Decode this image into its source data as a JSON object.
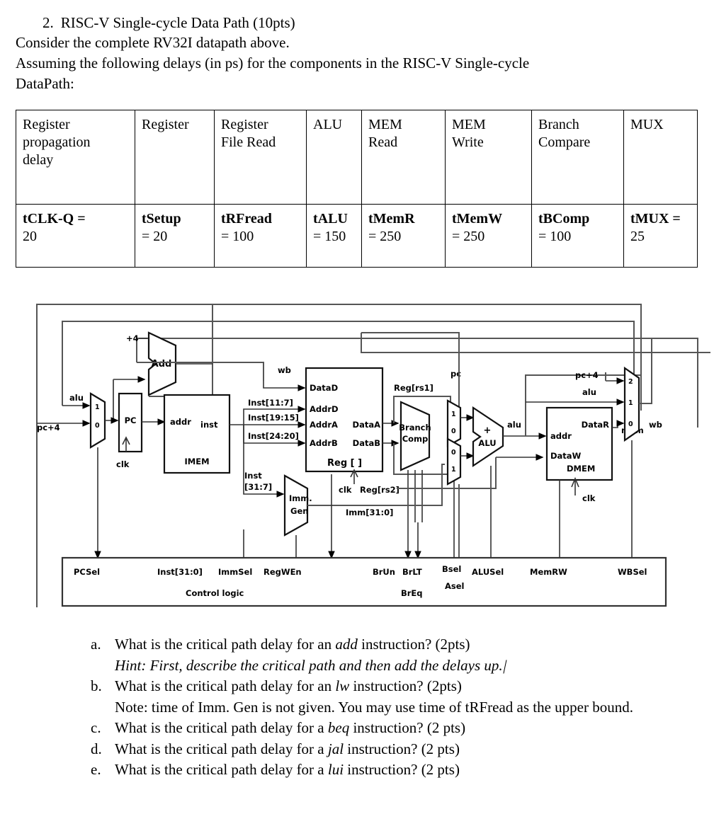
{
  "heading": {
    "number": "2.",
    "title": "RISC-V Single-cycle Data Path (10pts)",
    "line1": "Consider the complete RV32I datapath above.",
    "line2": "Assuming the following delays (in ps) for the components in the RISC-V Single-cycle",
    "line3": "DataPath:"
  },
  "delay_table": {
    "columns": [
      {
        "header": "Register propagation delay",
        "header_lines": [
          "Register",
          "propagation",
          "delay"
        ],
        "symbol": "tCLK-Q =",
        "value": "20"
      },
      {
        "header": "Register",
        "header_lines": [
          "Register"
        ],
        "symbol": "tSetup",
        "value": "= 20"
      },
      {
        "header": "Register File Read",
        "header_lines": [
          "Register",
          "File Read"
        ],
        "symbol": "tRFread",
        "value": "= 100"
      },
      {
        "header": "ALU",
        "header_lines": [
          "ALU"
        ],
        "symbol": "tALU",
        "value": "= 150"
      },
      {
        "header": "MEM Read",
        "header_lines": [
          "MEM",
          "Read"
        ],
        "symbol": "tMemR",
        "value": "= 250"
      },
      {
        "header": "MEM Write",
        "header_lines": [
          "MEM",
          "Write"
        ],
        "symbol": "tMemW",
        "value": "= 250"
      },
      {
        "header": "Branch Compare",
        "header_lines": [
          "Branch",
          "Compare"
        ],
        "symbol": "tBComp",
        "value": "= 100"
      },
      {
        "header": "MUX",
        "header_lines": [
          "MUX"
        ],
        "symbol": "tMUX =",
        "value": "25"
      }
    ]
  },
  "diagram": {
    "blocks": {
      "imem": "IMEM",
      "regfile": "Reg [ ]",
      "immgen_l1": "Imm.",
      "immgen_l2": "Gen",
      "branch_l1": "Branch",
      "branch_l2": "Comp",
      "alu_sym": "+",
      "alu_name": "ALU",
      "dmem": "DMEM",
      "add": "Add",
      "pc": "PC",
      "control": "Control logic"
    },
    "labels": {
      "plus4": "+4",
      "alu_top": "alu",
      "pc_plus4_left": "pc+4",
      "clk1": "clk",
      "clk2": "clk",
      "clk3": "clk",
      "addr_imem": "addr",
      "inst_out": "inst",
      "inst_11_7": "Inst[11:7]",
      "inst_19_15": "Inst[19:15]",
      "inst_24_20": "Inst[24:20]",
      "inst_31_7_l1": "Inst",
      "inst_31_7_l2": "[31:7]",
      "wb_left": "wb",
      "datad": "DataD",
      "addrd": "AddrD",
      "addra": "AddrA",
      "addrb": "AddrB",
      "dataa": "DataA",
      "datab": "DataB",
      "reg_rs1": "Reg[rs1]",
      "reg_rs2": "Reg[rs2]",
      "imm_31_0": "Imm[31:0]",
      "pc_mid": "pc",
      "alu_out": "alu",
      "addr_dmem": "addr",
      "dataw": "DataW",
      "datar": "DataR",
      "mem": "mem",
      "pc_plus4_right": "pc+4",
      "alu_right": "alu",
      "wb_right": "wb"
    },
    "mux_ports": {
      "pcsel_1": "1",
      "pcsel_0": "0",
      "asel_1": "1",
      "asel_0": "0",
      "bsel_0": "0",
      "bsel_1": "1",
      "wbsel_2": "2",
      "wbsel_1": "1",
      "wbsel_0": "0"
    },
    "control_signals": [
      "PCSel",
      "Inst[31:0]",
      "ImmSel",
      "RegWEn",
      "BrUn",
      "BrLT",
      "BrEq",
      "Bsel",
      "Asel",
      "ALUSel",
      "MemRW",
      "WBSel"
    ]
  },
  "questions": [
    {
      "marker": "a.",
      "text_before": "What is the critical path delay for an ",
      "emphasis": "add",
      "text_after": " instruction? (2pts)",
      "sub": "Hint: First, describe the critical path and then add the delays up.",
      "sub_italic": true
    },
    {
      "marker": "b.",
      "text_before": "What is the critical path delay for an ",
      "emphasis": "lw",
      "text_after": " instruction? (2pts)",
      "sub": "Note: time of Imm. Gen is not given. You may use time of tRFread as the upper bound.",
      "sub_italic": false
    },
    {
      "marker": "c.",
      "text_before": "What is the critical path delay for a ",
      "emphasis": "beq",
      "text_after": " instruction? (2 pts)",
      "sub": "",
      "sub_italic": false
    },
    {
      "marker": "d.",
      "text_before": "What is the critical path delay for a ",
      "emphasis": "jal",
      "text_after": " instruction? (2 pts)",
      "sub": "",
      "sub_italic": false
    },
    {
      "marker": "e.",
      "text_before": "What is the critical path delay for a ",
      "emphasis": "lui",
      "text_after": " instruction? (2 pts)",
      "sub": "",
      "sub_italic": false
    }
  ]
}
